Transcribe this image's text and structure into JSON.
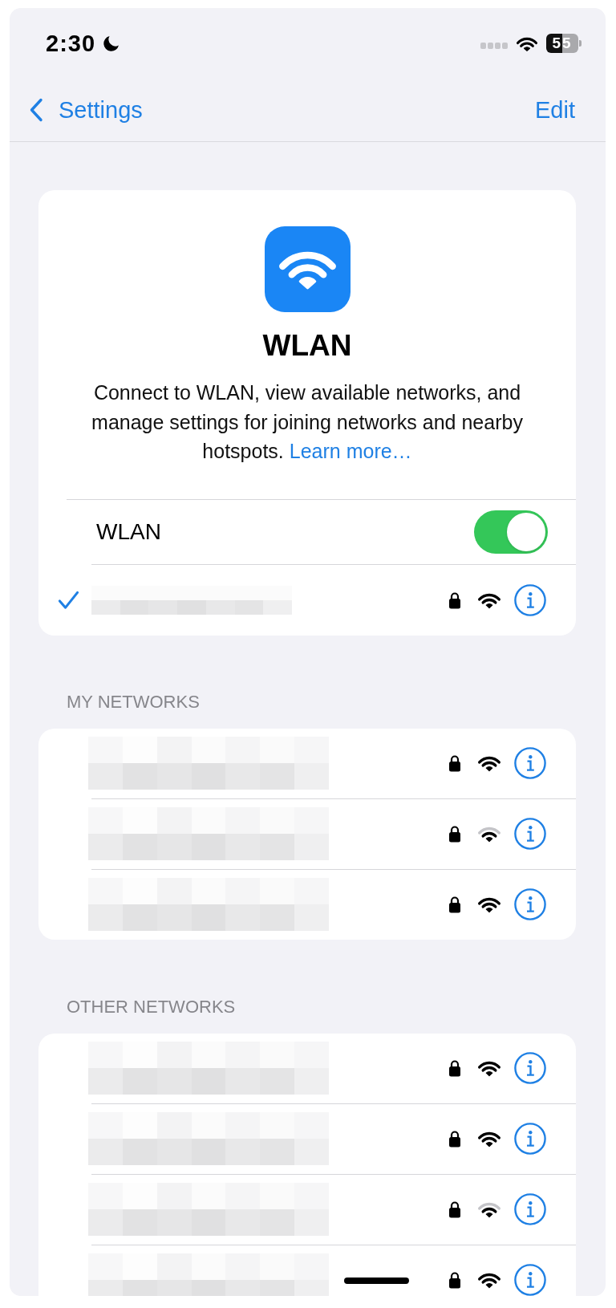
{
  "status_bar": {
    "time": "2:30",
    "focus_on": true,
    "battery": "55"
  },
  "nav": {
    "back": "Settings",
    "action": "Edit"
  },
  "header": {
    "title": "WLAN",
    "description": "Connect to WLAN, view available networks, and manage settings for joining networks and nearby hotspots.",
    "link": "Learn more…"
  },
  "wlan_switch": {
    "label": "WLAN",
    "on": true
  },
  "current_network": {
    "connected": true,
    "locked": true,
    "weak_signal": false
  },
  "sections": [
    {
      "title": "MY NETWORKS",
      "networks": [
        {
          "locked": true,
          "weak_signal": false
        },
        {
          "locked": true,
          "weak_signal": true
        },
        {
          "locked": true,
          "weak_signal": false
        }
      ]
    },
    {
      "title": "OTHER NETWORKS",
      "networks": [
        {
          "locked": true,
          "weak_signal": false
        },
        {
          "locked": true,
          "weak_signal": false
        },
        {
          "locked": true,
          "weak_signal": true
        },
        {
          "locked": true,
          "weak_signal": false
        }
      ]
    }
  ]
}
